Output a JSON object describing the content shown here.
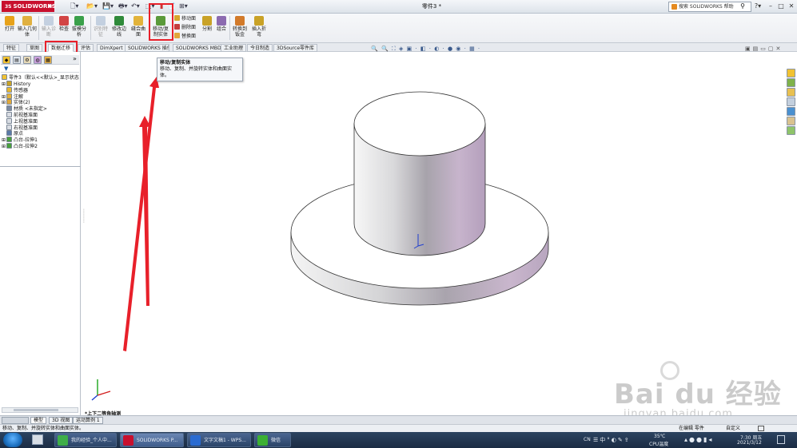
{
  "titlebar": {
    "app_name": "SOLIDWORKS",
    "ds_mark": "3S",
    "document_title": "零件3 *",
    "search_placeholder": "搜索 SOLIDWORKS 帮助",
    "search_icon": "magnifier-icon",
    "help_label": "?",
    "dropdown_glyph": "▾",
    "window_buttons": [
      "–",
      "□",
      "✕"
    ]
  },
  "ribbon": {
    "tools": [
      {
        "label": "打开",
        "color": "#e7a21b"
      },
      {
        "label": "输入几何体",
        "color": "#e0b040"
      },
      {
        "label": "输入诊断",
        "color": "#8aa3c4",
        "disabled": true
      },
      {
        "label": "检查",
        "color": "#d24545"
      },
      {
        "label": "拔模分析",
        "color": "#3aa04a"
      },
      {
        "label": "识别特征",
        "color": "#8aa3c4",
        "disabled": true
      },
      {
        "label": "修改边线",
        "color": "#2f8a3a"
      },
      {
        "label": "缝合曲面",
        "color": "#e2b33a"
      },
      {
        "label": "移动/复制实体",
        "color": "#5a9a3a"
      },
      {
        "label": "分割",
        "color": "#c9a227"
      },
      {
        "label": "组合",
        "color": "#8c6bb0"
      },
      {
        "label": "转换到钣金",
        "color": "#d27a2a"
      },
      {
        "label": "插入折弯",
        "color": "#c9a227"
      }
    ],
    "small_commands": [
      {
        "label": "移动面",
        "color": "#d6a62b"
      },
      {
        "label": "删除面",
        "color": "#c43c3c"
      },
      {
        "label": "替换面",
        "color": "#e0a83a"
      }
    ]
  },
  "tabs": [
    "特征",
    "草图",
    "数据迁移",
    "评估",
    "DimXpert",
    "SOLIDWORKS 插件",
    "SOLIDWORKS MBD",
    "工业助理",
    "今日制造",
    "3DSource零件库"
  ],
  "active_tab": "数据迁移",
  "view_toolbar_glyphs": "🔍 🔍 ⛶ ◈ ▣ · ◧ · ◐ · ● ◉ · ▦ ·",
  "panel_tab_glyphs": [
    "◆",
    "▤",
    "⚙",
    "◍",
    "▦"
  ],
  "panel_more": "»",
  "filter_icon": "▼",
  "tree": {
    "root": "零件3（默认<<默认>_显示状态",
    "items": [
      {
        "label": "History",
        "color": "#c9a227",
        "expand": "⊞"
      },
      {
        "label": "传感器",
        "color": "#e8b830",
        "expand": ""
      },
      {
        "label": "注解",
        "color": "#e3b23c",
        "expand": "⊞"
      },
      {
        "label": "实体(2)",
        "color": "#e0a83a",
        "expand": "⊞"
      },
      {
        "label": "材质 <未指定>",
        "color": "#7c8aa0",
        "expand": ""
      },
      {
        "label": "前视基准面",
        "color": "#d9dde3",
        "expand": ""
      },
      {
        "label": "上视基准面",
        "color": "#d9dde3",
        "expand": ""
      },
      {
        "label": "右视基准面",
        "color": "#d9dde3",
        "expand": ""
      },
      {
        "label": "原点",
        "color": "#5b7aa8",
        "expand": ""
      },
      {
        "label": "凸台-拉伸1",
        "color": "#4aa03a",
        "expand": "⊞"
      },
      {
        "label": "凸台-拉伸2",
        "color": "#4aa03a",
        "expand": "⊞"
      }
    ]
  },
  "tooltip": {
    "title": "移动/复制实体",
    "body": "移动、复制、并旋转实体和曲面实体。"
  },
  "viewport": {
    "view_name": "*上下二等角轴测"
  },
  "bottom_tabs": [
    "模型",
    "3D 视图",
    "运动算例 1"
  ],
  "status": {
    "message": "移动、复制、并旋转实体和曲面实体。",
    "editing": "在编辑 零件",
    "custom": "自定义"
  },
  "taskbar": {
    "buttons": [
      {
        "label": "我的经验_个人中...",
        "color": "#3fae49"
      },
      {
        "label": "SOLIDWORKS P...",
        "color": "#c8102e"
      },
      {
        "label": "文字文稿1 - WPS...",
        "color": "#2a6bd1"
      },
      {
        "label": "微信",
        "color": "#3cb034"
      }
    ],
    "lang": "CN",
    "temp": "35℃",
    "temp_label": "CPU温度",
    "time": "7:30 周五",
    "date": "2021/3/12"
  },
  "watermark": {
    "brand": "Bai du 经验",
    "url": "jingyan.baidu.com"
  }
}
